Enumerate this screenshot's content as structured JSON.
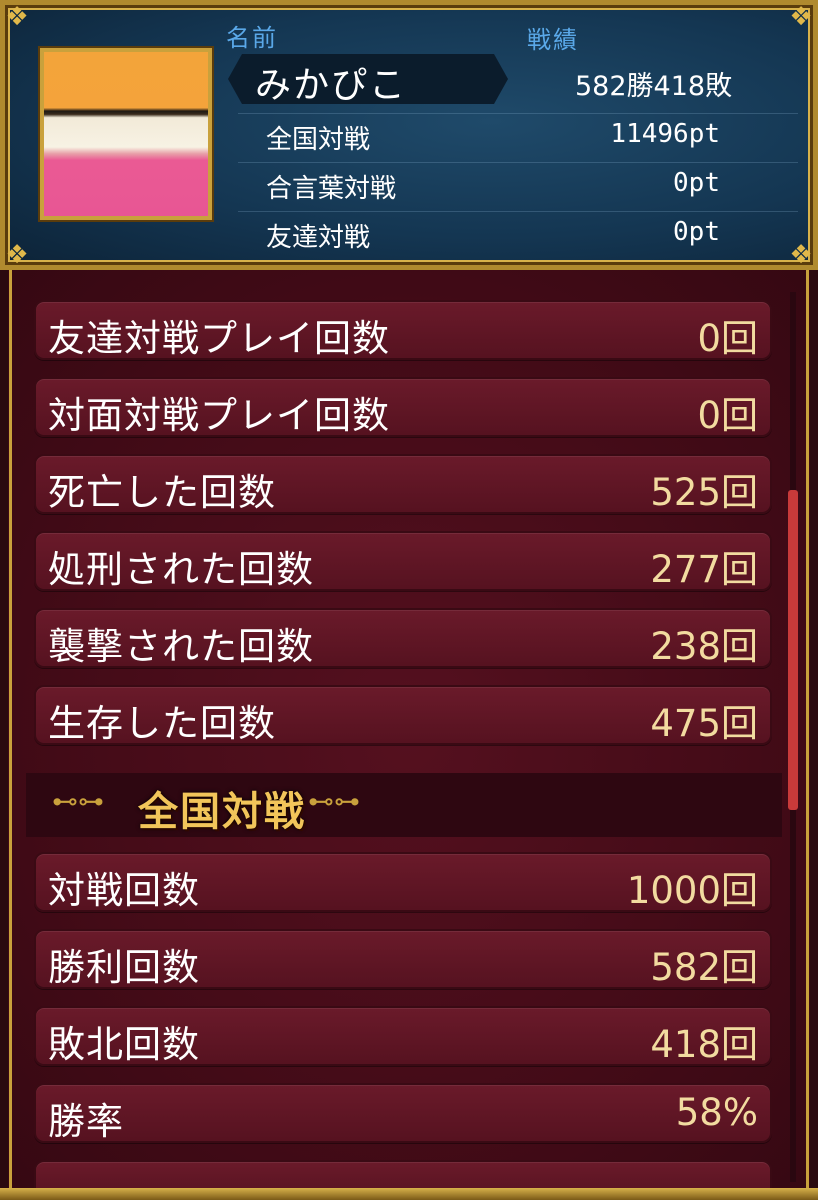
{
  "profile": {
    "name_label": "名前",
    "record_label": "戦績",
    "name": "みかぴこ",
    "record": "582勝418敗",
    "points": [
      {
        "label": "全国対戦",
        "value": "11496pt"
      },
      {
        "label": "合言葉対戦",
        "value": "0pt"
      },
      {
        "label": "友達対戦",
        "value": "0pt"
      }
    ]
  },
  "stats": [
    {
      "label": "友達対戦プレイ回数",
      "value": "0回"
    },
    {
      "label": "対面対戦プレイ回数",
      "value": "0回"
    },
    {
      "label": "死亡した回数",
      "value": "525回"
    },
    {
      "label": "処刑された回数",
      "value": "277回"
    },
    {
      "label": "襲撃された回数",
      "value": "238回"
    },
    {
      "label": "生存した回数",
      "value": "475回"
    }
  ],
  "national": {
    "title": "全国対戦",
    "stats": [
      {
        "label": "対戦回数",
        "value": "1000回"
      },
      {
        "label": "勝利回数",
        "value": "582回"
      },
      {
        "label": "敗北回数",
        "value": "418回"
      },
      {
        "label": "勝率",
        "value": "58%"
      }
    ]
  },
  "colors": {
    "header_bg": "#143652",
    "main_bg": "#430b17",
    "gold_frame": "#c9a13c",
    "label_blue": "#5aa8e8",
    "value_gold": "#f2dba0",
    "section_title": "#f2c55a",
    "scroll_thumb": "#c83a3a"
  },
  "icons": [
    "corner-ornament-icon",
    "section-ornament-icon"
  ]
}
